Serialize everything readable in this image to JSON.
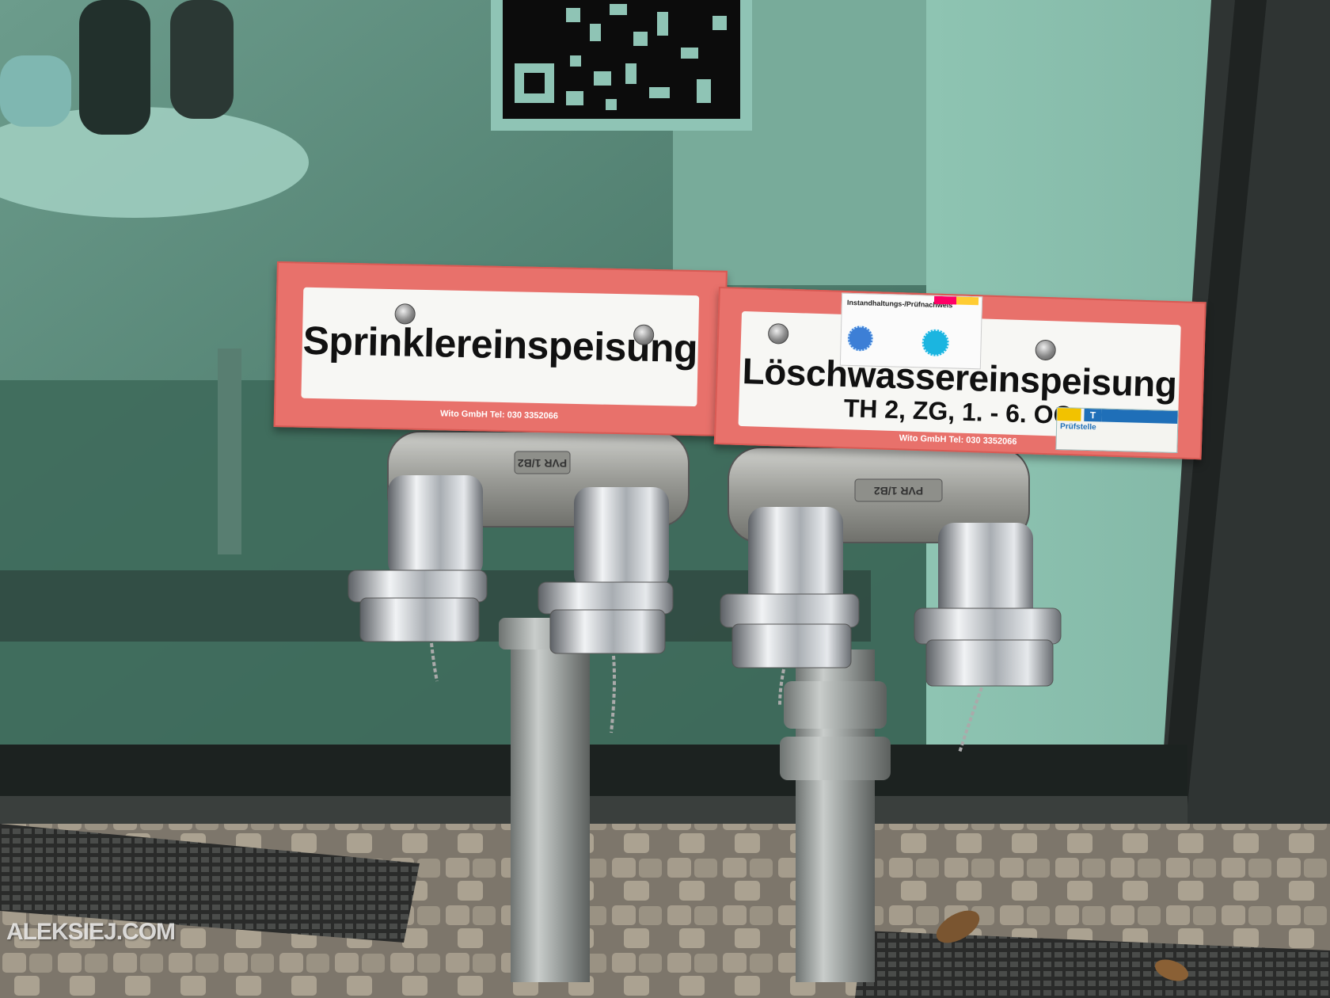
{
  "signs": {
    "left": {
      "title": "Sprinklereinspeisung",
      "maker": "Wito GmbH Tel: 030 3352066"
    },
    "right": {
      "title": "Löschwassereinspeisung",
      "subtitle": "TH 2, ZG, 1. - 6. OG",
      "maker": "Wito GmbH Tel: 030 3352066"
    }
  },
  "inspection_sticker": {
    "heading": "Instandhaltungs-/Prüfnachweis"
  },
  "test_tag": {
    "badge": "T",
    "label": "Prüfstelle"
  },
  "valve_marking": "PVR 1/B2",
  "watermark": "ALEKSIEJ.COM",
  "colors": {
    "sign_red": "#e8716b",
    "sign_white": "#f7f7f4",
    "glass_teal": "#5c8a7c",
    "chrome": "#c9ccd0"
  }
}
